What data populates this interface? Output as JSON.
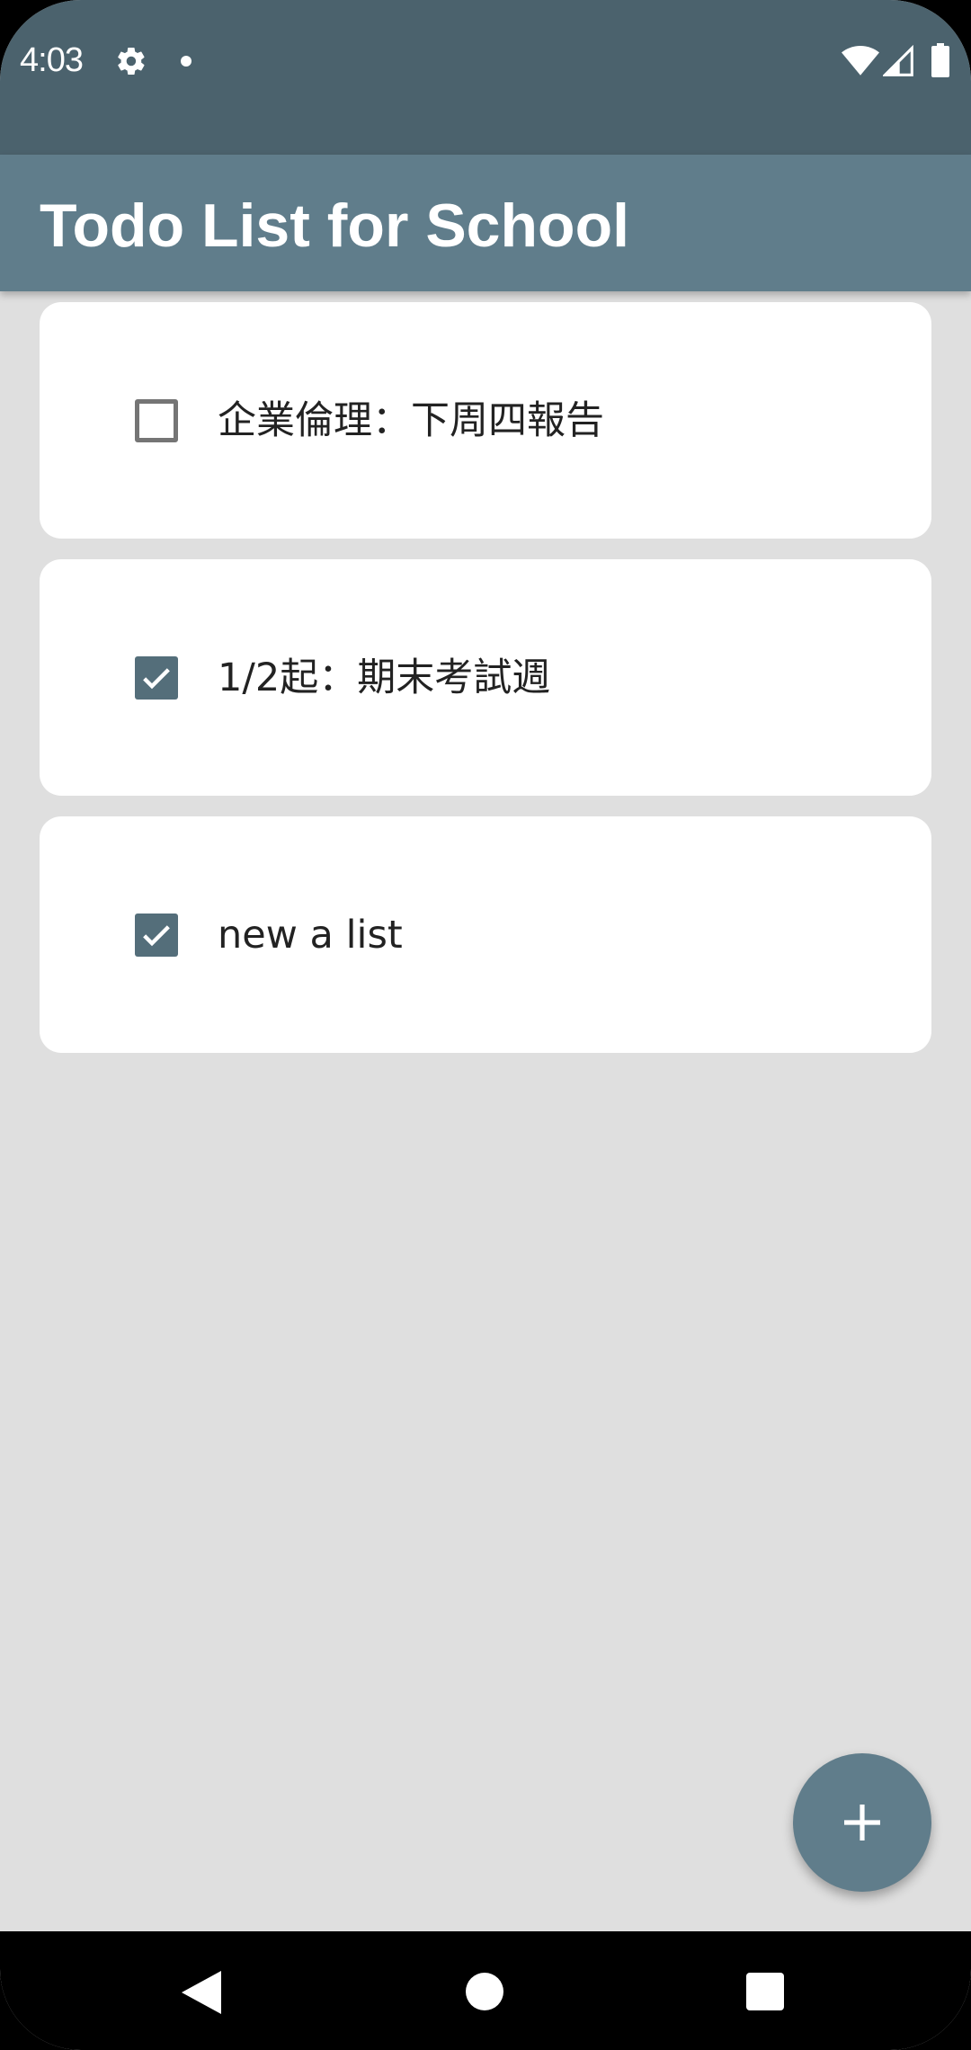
{
  "status_bar": {
    "time": "4:03",
    "icons": [
      "gear-icon",
      "notification-dot-icon",
      "wifi-icon",
      "signal-icon",
      "battery-icon"
    ]
  },
  "app_bar": {
    "title": "Todo List for School"
  },
  "todo_items": [
    {
      "label": "企業倫理：下周四報告",
      "checked": false
    },
    {
      "label": "1/2起：期末考試週",
      "checked": true
    },
    {
      "label": "new a list",
      "checked": true
    }
  ],
  "fab": {
    "icon": "plus-icon"
  },
  "nav_bar": {
    "icons": [
      "back-icon",
      "home-icon",
      "recents-icon"
    ]
  },
  "colors": {
    "status_bar": "#4b626d",
    "app_bar": "#607d8b",
    "checkbox_checked": "#546e7a",
    "background": "#dfdfdf",
    "card": "#ffffff"
  }
}
